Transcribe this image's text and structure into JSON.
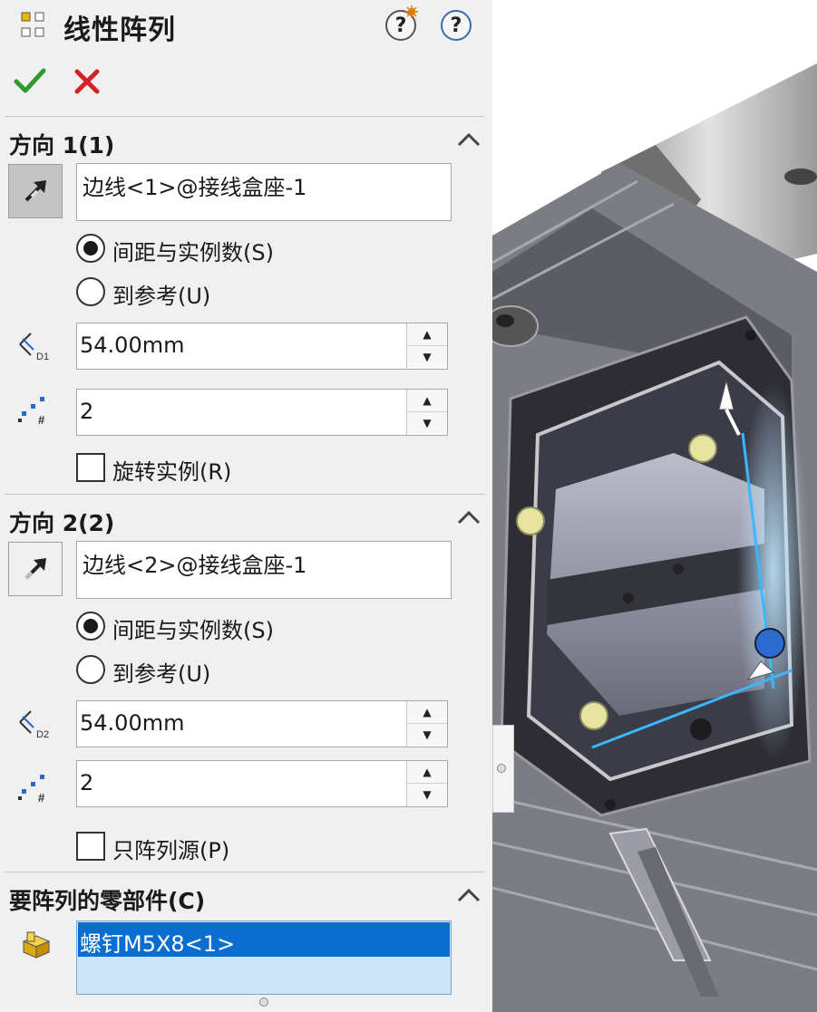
{
  "header": {
    "title": "线性阵列",
    "whats_new_icon": "question-new-icon",
    "help_icon": "question-icon",
    "help_glyph": "?"
  },
  "actions": {
    "ok_icon": "checkmark-icon",
    "cancel_icon": "close-icon"
  },
  "direction1": {
    "title": "方向 1(1)",
    "edge": "边线<1>@接线盒座-1",
    "radio_spacing": "间距与实例数(S)",
    "radio_reference": "到参考(U)",
    "spacing": "54.00mm",
    "count": "2",
    "checkbox_label": "旋转实例(R)",
    "spacing_icon_label": "D1"
  },
  "direction2": {
    "title": "方向 2(2)",
    "edge": "边线<2>@接线盒座-1",
    "radio_spacing": "间距与实例数(S)",
    "radio_reference": "到参考(U)",
    "spacing": "54.00mm",
    "count": "2",
    "checkbox_label": "只阵列源(P)",
    "spacing_icon_label": "D2"
  },
  "components": {
    "title": "要阵列的零部件(C)",
    "items": [
      "螺钉M5X8<1>"
    ]
  },
  "colors": {
    "accent": "#0a6ecf",
    "ok": "#2e9a2e",
    "cancel": "#d32222"
  }
}
